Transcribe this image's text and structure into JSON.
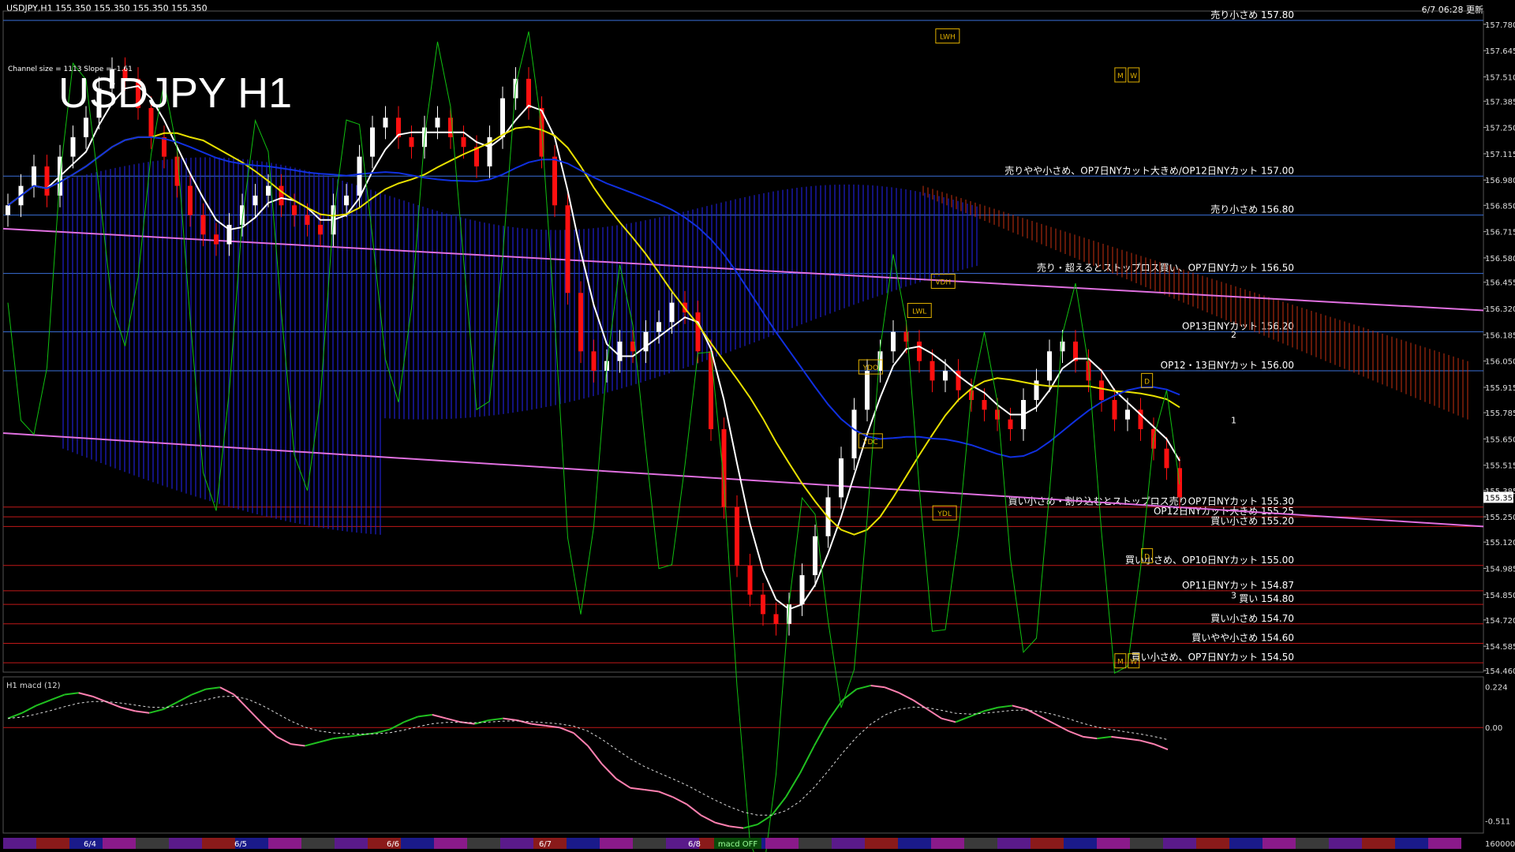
{
  "header": {
    "symbol_info": "USDJPY,H1  155.350 155.350 155.350 155.350",
    "timestamp": "6/7 06:28 更新",
    "big_title": "USDJPY H1",
    "channel_info": "Channel size = 1113 Slope = -1.61"
  },
  "price_axis": {
    "labels": [
      "157.780",
      "157.645",
      "157.510",
      "157.385",
      "157.250",
      "157.115",
      "156.980",
      "156.850",
      "156.715",
      "156.580",
      "156.455",
      "156.320",
      "156.185",
      "156.050",
      "155.915",
      "155.785",
      "155.650",
      "155.515",
      "155.385",
      "155.250",
      "155.120",
      "154.985",
      "154.850",
      "154.720",
      "154.585",
      "154.460"
    ],
    "current_price": "155.350",
    "min": 154.46,
    "max": 157.84
  },
  "macd": {
    "label": "H1  macd (12)",
    "axis_labels": [
      "0.224",
      "0.00",
      "-0.511"
    ],
    "min": -0.56,
    "max": 0.26
  },
  "date_labels": [
    "6/4",
    "6/5",
    "6/6",
    "6/7",
    "6/8"
  ],
  "bottom_right": "160000",
  "bottom_tag": "macd OFF",
  "levels": [
    {
      "label": "売り小さめ 157.80",
      "price": 157.8,
      "color": "#3a6fd8"
    },
    {
      "label": "売りやや小さめ、OP7日NYカット大きめ/OP12日NYカット 157.00",
      "price": 157.0,
      "color": "#3a6fd8"
    },
    {
      "label": "売り小さめ 156.80",
      "price": 156.8,
      "color": "#3a6fd8"
    },
    {
      "label": "売り・超えるとストップロス買い、OP7日NYカット 156.50",
      "price": 156.5,
      "color": "#3a6fd8"
    },
    {
      "label": "OP13日NYカット 156.20",
      "price": 156.2,
      "color": "#3a6fd8"
    },
    {
      "label": "OP12・13日NYカット 156.00",
      "price": 156.0,
      "color": "#3a6fd8"
    },
    {
      "label": "買い小さめ・割り込むとストップロス売りOP7日NYカット 155.30",
      "price": 155.3,
      "color": "#c01818"
    },
    {
      "label": "OP12日NYカット大きめ 155.25",
      "price": 155.25,
      "color": "#c01818"
    },
    {
      "label": "買い小さめ 155.20",
      "price": 155.2,
      "color": "#c01818"
    },
    {
      "label": "買い小さめ、OP10日NYカット 155.00",
      "price": 155.0,
      "color": "#c01818"
    },
    {
      "label": "OP11日NYカット 154.87",
      "price": 154.87,
      "color": "#c01818"
    },
    {
      "label": "買い 154.80",
      "price": 154.8,
      "color": "#c01818"
    },
    {
      "label": "買い小さめ 154.70",
      "price": 154.7,
      "color": "#c01818"
    },
    {
      "label": "買いやや小さめ 154.60",
      "price": 154.6,
      "color": "#c01818"
    },
    {
      "label": "買い小さめ、OP7日NYカット 154.50",
      "price": 154.5,
      "color": "#c01818"
    }
  ],
  "markers": [
    {
      "label": "LWH",
      "price": 157.72,
      "x": 0.63
    },
    {
      "label": "M",
      "price": 157.52,
      "x": 0.751
    },
    {
      "label": "W",
      "price": 157.52,
      "x": 0.76
    },
    {
      "label": "VDH",
      "price": 156.46,
      "x": 0.627
    },
    {
      "label": "LWL",
      "price": 156.31,
      "x": 0.611
    },
    {
      "label": "YDO",
      "price": 156.02,
      "x": 0.578
    },
    {
      "label": "YDC",
      "price": 155.64,
      "x": 0.578
    },
    {
      "label": "YDL",
      "price": 155.27,
      "x": 0.628
    },
    {
      "label": "D",
      "price": 155.95,
      "x": 0.769
    },
    {
      "label": "D",
      "price": 155.05,
      "x": 0.769
    },
    {
      "label": "M",
      "price": 154.51,
      "x": 0.751
    },
    {
      "label": "W",
      "price": 154.51,
      "x": 0.76
    }
  ],
  "projection_labels": [
    {
      "label": "2",
      "price": 156.17
    },
    {
      "label": "1",
      "price": 155.73
    },
    {
      "label": "3",
      "price": 154.83
    }
  ],
  "colors": {
    "bull": "#ffffff",
    "bear": "#ff1010",
    "blue_level": "#3a6fd8",
    "red_level": "#c01818",
    "cloud_blue": "#2020d0",
    "cloud_red": "#c03010",
    "ma_white": "#ffffff",
    "ma_yellow": "#e8e000",
    "ma_blue": "#1030e0",
    "green": "#10c010",
    "channel": "#e070e0"
  },
  "chart_data": {
    "type": "candlestick",
    "title": "USDJPY H1",
    "ylim": [
      154.46,
      157.84
    ],
    "x_categories": [
      "6/4",
      "6/5",
      "6/6",
      "6/7",
      "6/8"
    ],
    "price_closes": [
      156.85,
      156.95,
      157.05,
      156.9,
      157.1,
      157.2,
      157.3,
      157.45,
      157.55,
      157.5,
      157.35,
      157.2,
      157.1,
      156.95,
      156.8,
      156.7,
      156.65,
      156.75,
      156.85,
      156.9,
      156.95,
      156.85,
      156.8,
      156.75,
      156.7,
      156.85,
      156.9,
      157.1,
      157.25,
      157.3,
      157.2,
      157.15,
      157.25,
      157.3,
      157.2,
      157.15,
      157.05,
      157.2,
      157.4,
      157.5,
      157.35,
      157.1,
      156.85,
      156.4,
      156.1,
      156.0,
      156.05,
      156.15,
      156.1,
      156.2,
      156.25,
      156.35,
      156.3,
      156.1,
      155.7,
      155.3,
      155.0,
      154.85,
      154.75,
      154.7,
      154.8,
      154.95,
      155.15,
      155.35,
      155.55,
      155.8,
      156.0,
      156.1,
      156.2,
      156.15,
      156.05,
      155.95,
      156.0,
      155.9,
      155.85,
      155.8,
      155.75,
      155.7,
      155.85,
      155.95,
      156.1,
      156.15,
      156.05,
      155.95,
      155.85,
      155.75,
      155.8,
      155.7,
      155.6,
      155.5,
      155.35
    ],
    "macd": [
      0.05,
      0.08,
      0.12,
      0.15,
      0.18,
      0.19,
      0.17,
      0.14,
      0.11,
      0.09,
      0.08,
      0.1,
      0.14,
      0.18,
      0.21,
      0.22,
      0.18,
      0.1,
      0.02,
      -0.05,
      -0.09,
      -0.1,
      -0.08,
      -0.06,
      -0.05,
      -0.04,
      -0.03,
      -0.01,
      0.03,
      0.06,
      0.07,
      0.05,
      0.03,
      0.02,
      0.04,
      0.05,
      0.04,
      0.02,
      0.01,
      0.0,
      -0.03,
      -0.1,
      -0.2,
      -0.28,
      -0.33,
      -0.34,
      -0.35,
      -0.38,
      -0.42,
      -0.48,
      -0.52,
      -0.54,
      -0.55,
      -0.53,
      -0.48,
      -0.38,
      -0.25,
      -0.1,
      0.04,
      0.15,
      0.21,
      0.23,
      0.22,
      0.19,
      0.15,
      0.1,
      0.05,
      0.03,
      0.06,
      0.09,
      0.11,
      0.12,
      0.1,
      0.06,
      0.02,
      -0.02,
      -0.05,
      -0.06,
      -0.05,
      -0.06,
      -0.07,
      -0.09,
      -0.12
    ]
  }
}
